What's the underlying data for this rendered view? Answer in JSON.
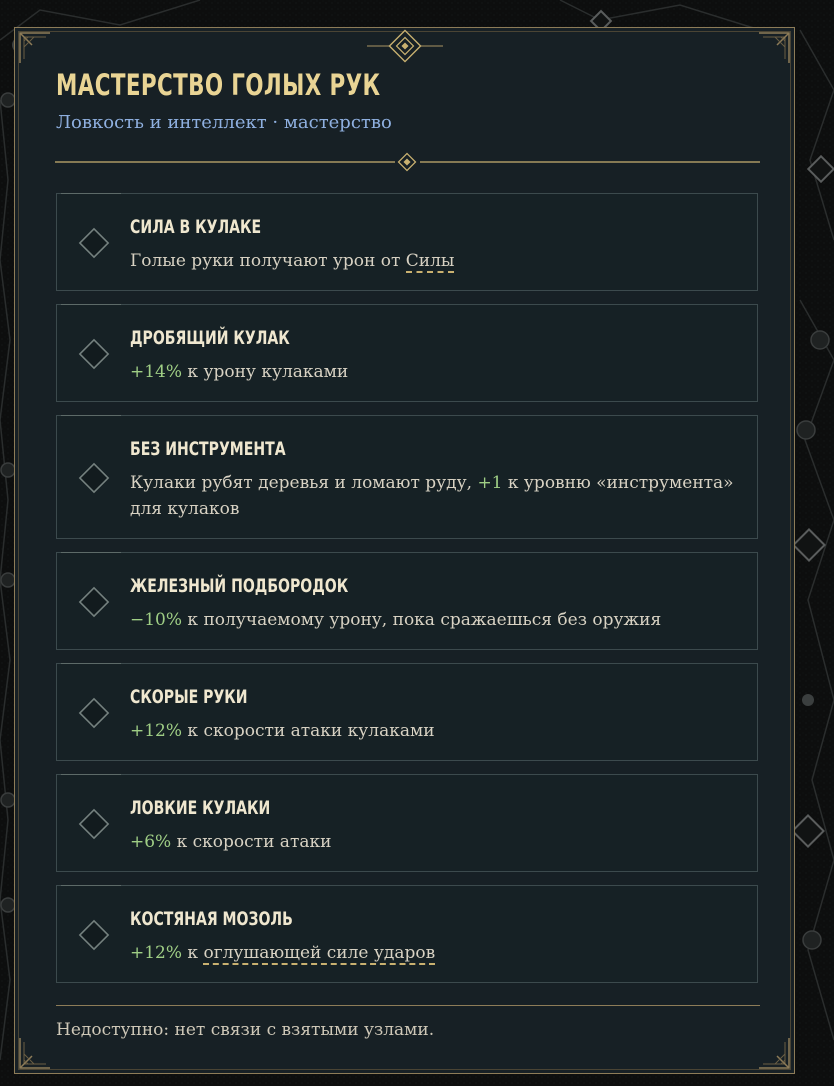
{
  "panel": {
    "title": "Мастерство голых рук",
    "subtitle_attrs": "Ловкость и интеллект",
    "subtitle_sep": " · ",
    "subtitle_kind": "мастерство"
  },
  "perks": [
    {
      "name": "Сила в кулаке",
      "desc_pre": "Голые руки получают урон от ",
      "link": "Силы"
    },
    {
      "name": "Дробящий кулак",
      "num": "+14%",
      "desc": " к урону кулаками"
    },
    {
      "name": "Без инструмента",
      "desc_pre": "Кулаки рубят деревья и ломают руду, ",
      "num": "+1",
      "desc_post": " к уровню «инструмента» для кулаков"
    },
    {
      "name": "Железный подбородок",
      "num": "−10%",
      "desc": " к получаемому урону, пока сражаешься без оружия"
    },
    {
      "name": "Скорые руки",
      "num": "+12%",
      "desc": " к скорости атаки кулаками"
    },
    {
      "name": "Ловкие кулаки",
      "num": "+6%",
      "desc": " к скорости атаки"
    },
    {
      "name": "Костяная мозоль",
      "num": "+12%",
      "desc_mid": " к ",
      "link": "оглушающей силе ударов"
    }
  ],
  "status": "Недоступно: нет связи с взятыми узлами.",
  "colors": {
    "gold": "#e9d494",
    "accent_blue": "#8fb0e0",
    "positive_green": "#9fce85",
    "border": "#8d7c58"
  }
}
